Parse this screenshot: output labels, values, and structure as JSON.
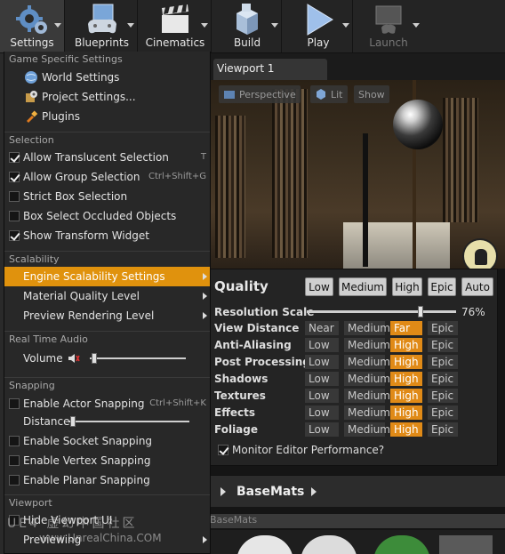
{
  "toolbar": {
    "buttons": [
      {
        "label": "Settings",
        "icon": "gears-icon"
      },
      {
        "label": "Blueprints",
        "icon": "blueprint-controller-icon"
      },
      {
        "label": "Cinematics",
        "icon": "clapperboard-icon"
      },
      {
        "label": "Build",
        "icon": "build-blocks-icon"
      },
      {
        "label": "Play",
        "icon": "play-icon"
      },
      {
        "label": "Launch",
        "icon": "launch-console-icon"
      }
    ]
  },
  "viewport": {
    "tab_label": "Viewport 1",
    "perspective_label": "Perspective",
    "lit_label": "Lit",
    "show_label": "Show"
  },
  "menu": {
    "game_specific": {
      "header": "Game Specific Settings",
      "items": [
        "World Settings",
        "Project Settings...",
        "Plugins"
      ]
    },
    "selection": {
      "header": "Selection",
      "items": [
        {
          "label": "Allow Translucent Selection",
          "checked": true,
          "shortcut": "T"
        },
        {
          "label": "Allow Group Selection",
          "checked": true,
          "shortcut": "Ctrl+Shift+G"
        },
        {
          "label": "Strict Box Selection",
          "checked": false,
          "shortcut": ""
        },
        {
          "label": "Box Select Occluded Objects",
          "checked": false,
          "shortcut": ""
        },
        {
          "label": "Show Transform Widget",
          "checked": true,
          "shortcut": ""
        }
      ]
    },
    "scalability": {
      "header": "Scalability",
      "items": [
        "Engine Scalability Settings",
        "Material Quality Level",
        "Preview Rendering Level"
      ]
    },
    "audio": {
      "header": "Real Time Audio",
      "volume_label": "Volume",
      "volume_level": 0.0
    },
    "snapping": {
      "header": "Snapping",
      "actor_snapping": {
        "label": "Enable Actor Snapping",
        "checked": false,
        "shortcut": "Ctrl+Shift+K"
      },
      "distance_label": "Distance",
      "distance_level": 0.0,
      "items": [
        {
          "label": "Enable Socket Snapping",
          "checked": false
        },
        {
          "label": "Enable Vertex Snapping",
          "checked": false
        },
        {
          "label": "Enable Planar Snapping",
          "checked": false
        }
      ]
    },
    "viewport": {
      "header": "Viewport",
      "items": [
        "Hide Viewport UI",
        "Previewing"
      ]
    }
  },
  "scalability_panel": {
    "title": "Quality",
    "presets": [
      "Low",
      "Medium",
      "High",
      "Epic",
      "Auto"
    ],
    "resolution_scale": {
      "label": "Resolution Scale",
      "value": "76%",
      "level": 0.76
    },
    "rows": [
      {
        "label": "View Distance",
        "options": [
          "Near",
          "Medium",
          "Far",
          "Epic"
        ],
        "active": 2
      },
      {
        "label": "Anti-Aliasing",
        "options": [
          "Low",
          "Medium",
          "High",
          "Epic"
        ],
        "active": 2
      },
      {
        "label": "Post Processing",
        "options": [
          "Low",
          "Medium",
          "High",
          "Epic"
        ],
        "active": 2
      },
      {
        "label": "Shadows",
        "options": [
          "Low",
          "Medium",
          "High",
          "Epic"
        ],
        "active": 2
      },
      {
        "label": "Textures",
        "options": [
          "Low",
          "Medium",
          "High",
          "Epic"
        ],
        "active": 2
      },
      {
        "label": "Effects",
        "options": [
          "Low",
          "Medium",
          "High",
          "Epic"
        ],
        "active": 2
      },
      {
        "label": "Foliage",
        "options": [
          "Low",
          "Medium",
          "High",
          "Epic"
        ],
        "active": 2
      }
    ],
    "monitor_label": "Monitor Editor Performance?",
    "monitor_checked": true
  },
  "content_browser": {
    "folder_label": "BaseMats",
    "crumb_label": "BaseMats"
  },
  "watermark": {
    "line1": "UE4 虚幻中国社区",
    "line2": "www.UnrealChina.COM"
  },
  "colors": {
    "accent": "#e0920d",
    "active_option": "#e08a17"
  }
}
